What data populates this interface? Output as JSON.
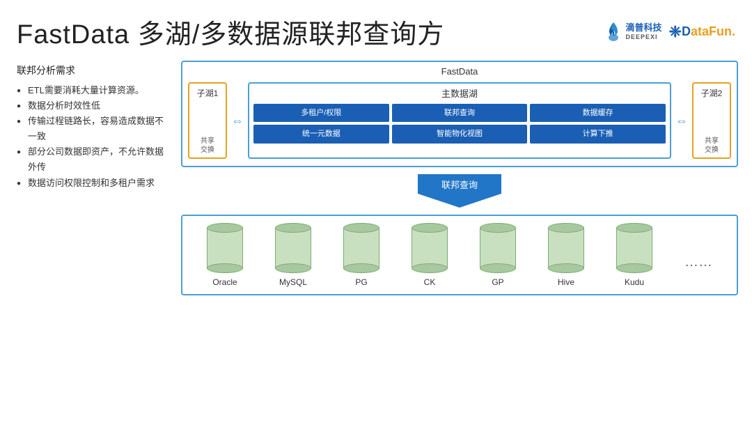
{
  "header": {
    "title": "FastData 多湖/多数据源联邦查询方",
    "logo_deepexi_text": "滴普科技\nDEEPEXI",
    "logo_datafun_text": "DataFun."
  },
  "left": {
    "section_title": "联邦分析需求",
    "bullets": [
      "ETL需要消耗大量计算资源。",
      "数据分析时效性低",
      "传输过程链路长，容易造成数据不一致",
      "部分公司数据即资产，不允许数据外传",
      "数据访问权限控制和多租户需求"
    ]
  },
  "diagram": {
    "fastdata_label": "FastData",
    "sub_lake1_title": "子湖1",
    "sub_lake1_share": "共享\n交换",
    "sub_lake2_title": "子湖2",
    "sub_lake2_share": "共享\n交换",
    "main_lake_title": "主数据湖",
    "grid_cells": [
      "多租户/权限",
      "联邦查询",
      "数据缓存",
      "统一元数据",
      "智能物化视图",
      "计算下推"
    ],
    "federation_label": "联邦查询",
    "datasources": [
      "Oracle",
      "MySQL",
      "PG",
      "CK",
      "GP",
      "Hive",
      "Kudu",
      "……"
    ]
  }
}
